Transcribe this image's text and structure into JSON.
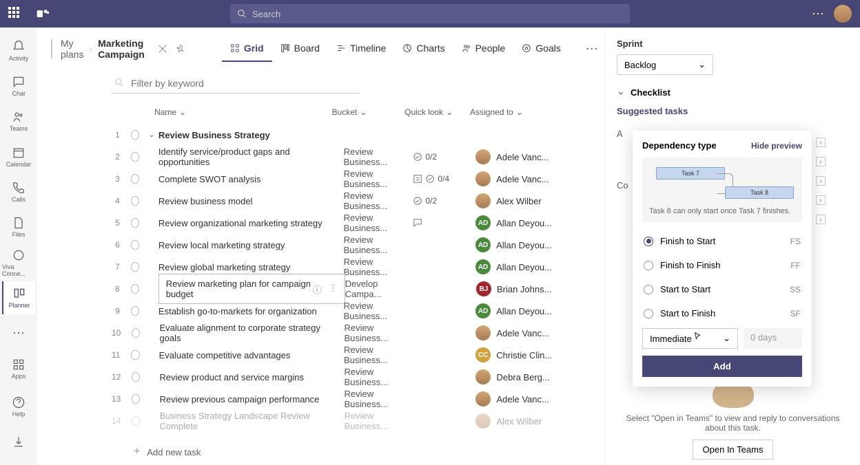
{
  "search_placeholder": "Search",
  "rail": {
    "items": [
      {
        "label": "Activity",
        "icon": "bell"
      },
      {
        "label": "Chat",
        "icon": "chat"
      },
      {
        "label": "Teams",
        "icon": "teams"
      },
      {
        "label": "Calendar",
        "icon": "calendar"
      },
      {
        "label": "Calls",
        "icon": "phone"
      },
      {
        "label": "Files",
        "icon": "file"
      },
      {
        "label": "Viva Conne...",
        "icon": "viva"
      },
      {
        "label": "Planner",
        "icon": "planner"
      },
      {
        "label": "",
        "icon": "dots"
      },
      {
        "label": "Apps",
        "icon": "apps"
      }
    ],
    "bottom": [
      {
        "label": "Help",
        "icon": "help"
      },
      {
        "label": "",
        "icon": "download"
      }
    ]
  },
  "breadcrumb": {
    "parent": "My plans",
    "current": "Marketing Campaign"
  },
  "view_tabs": [
    {
      "label": "Grid",
      "icon": "grid",
      "active": true
    },
    {
      "label": "Board",
      "icon": "board"
    },
    {
      "label": "Timeline",
      "icon": "timeline"
    },
    {
      "label": "Charts",
      "icon": "charts"
    },
    {
      "label": "People",
      "icon": "people"
    },
    {
      "label": "Goals",
      "icon": "goals"
    }
  ],
  "filter_placeholder": "Filter by keyword",
  "columns": {
    "name": "Name",
    "bucket": "Bucket",
    "quick": "Quick look",
    "assigned": "Assigned to"
  },
  "rows": [
    {
      "n": "1",
      "group": true,
      "name": "Review Business Strategy"
    },
    {
      "n": "2",
      "name": "Identify service/product gaps and opportunities",
      "bucket": "Review Business...",
      "quick": {
        "check": "0/2"
      },
      "assignee": {
        "name": "Adele Vanc...",
        "cls": "av-adele",
        "img": true
      }
    },
    {
      "n": "3",
      "name": "Complete SWOT analysis",
      "bucket": "Review Business...",
      "quick": {
        "note": true,
        "check": "0/4"
      },
      "assignee": {
        "name": "Adele Vanc...",
        "cls": "av-adele",
        "img": true
      }
    },
    {
      "n": "4",
      "name": "Review business model",
      "bucket": "Review Business...",
      "quick": {
        "check": "0/2"
      },
      "assignee": {
        "name": "Alex Wilber",
        "cls": "av-alex",
        "img": true
      }
    },
    {
      "n": "5",
      "name": "Review organizational marketing strategy",
      "bucket": "Review Business...",
      "quick": {
        "comment": true
      },
      "assignee": {
        "name": "Allan Deyou...",
        "cls": "av-allan",
        "initials": "AD"
      }
    },
    {
      "n": "6",
      "name": "Review local marketing strategy",
      "bucket": "Review Business...",
      "assignee": {
        "name": "Allan Deyou...",
        "cls": "av-allan",
        "initials": "AD"
      }
    },
    {
      "n": "7",
      "name": "Review global marketing strategy",
      "bucket": "Review Business...",
      "assignee": {
        "name": "Allan Deyou...",
        "cls": "av-allan",
        "initials": "AD"
      }
    },
    {
      "n": "8",
      "selected": true,
      "name": "Review marketing plan for campaign budget",
      "bucket": "Develop Campa...",
      "assignee": {
        "name": "Brian Johns...",
        "cls": "av-brian",
        "initials": "BJ"
      }
    },
    {
      "n": "9",
      "name": "Establish go-to-markets for organization",
      "bucket": "Review Business...",
      "assignee": {
        "name": "Allan Deyou...",
        "cls": "av-allan",
        "initials": "AD"
      }
    },
    {
      "n": "10",
      "name": "Evaluate alignment to corporate strategy goals",
      "bucket": "Review Business...",
      "assignee": {
        "name": "Adele Vanc...",
        "cls": "av-adele",
        "img": true
      }
    },
    {
      "n": "11",
      "name": "Evaluate competitive advantages",
      "bucket": "Review Business...",
      "assignee": {
        "name": "Christie Clin...",
        "cls": "av-christie",
        "initials": "CC"
      }
    },
    {
      "n": "12",
      "name": "Review product and service margins",
      "bucket": "Review Business...",
      "assignee": {
        "name": "Debra Berg...",
        "cls": "av-debra",
        "img": true
      }
    },
    {
      "n": "13",
      "name": "Review previous campaign performance",
      "bucket": "Review Business...",
      "assignee": {
        "name": "Adele Vanc...",
        "cls": "av-adele",
        "img": true
      }
    },
    {
      "n": "14",
      "name": "Business Strategy Landscape Review Complete",
      "bucket": "Review Business...",
      "assignee": {
        "name": "Alex Wilber",
        "cls": "av-alex",
        "img": true
      },
      "faded": true
    }
  ],
  "add_task": "Add new task",
  "panel": {
    "sprint_label": "Sprint",
    "sprint_value": "Backlog",
    "checklist_label": "Checklist",
    "suggested": "Suggested tasks",
    "dep_type": "Dependency type",
    "hide_preview": "Hide preview",
    "task7": "Task 7",
    "task8": "Task 8",
    "dep_desc": "Task 8 can only start once Task 7 finishes.",
    "options": [
      {
        "label": "Finish to Start",
        "abbr": "FS",
        "selected": true
      },
      {
        "label": "Finish to Finish",
        "abbr": "FF"
      },
      {
        "label": "Start to Start",
        "abbr": "SS"
      },
      {
        "label": "Start to Finish",
        "abbr": "SF"
      }
    ],
    "lag_mode": "Immediate",
    "lag_days": "0 days",
    "add": "Add",
    "help_text": "Select \"Open in Teams\" to view and reply to conversations about this task.",
    "open_teams": "Open In Teams",
    "partial_a": "A",
    "partial_co": "Co"
  }
}
